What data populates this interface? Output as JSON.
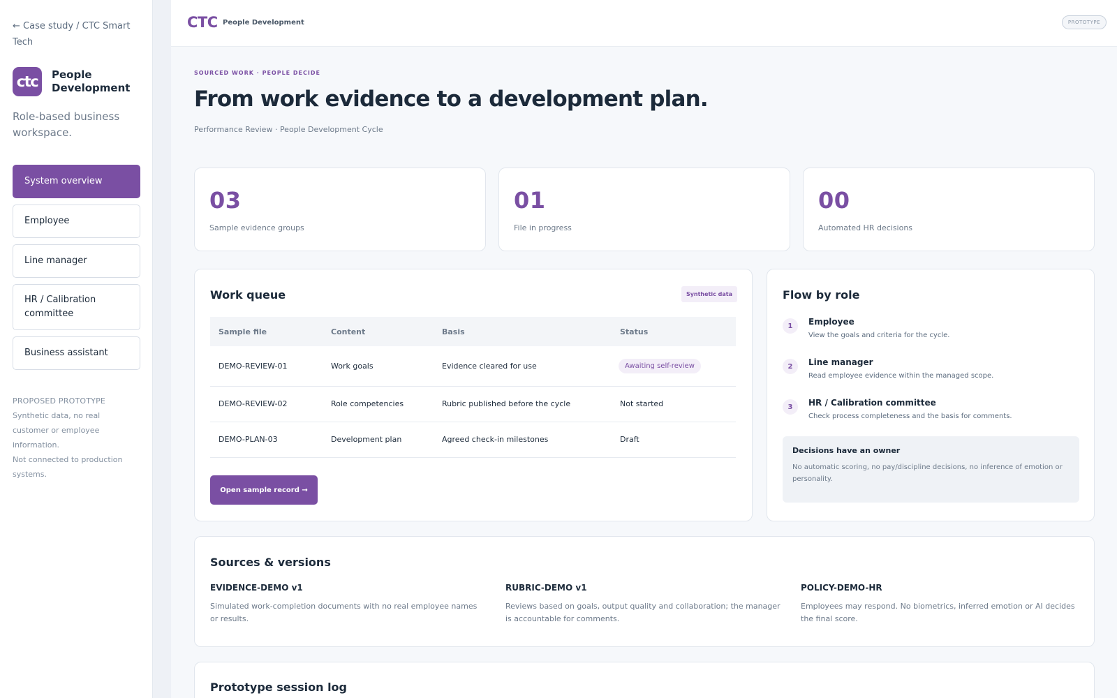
{
  "sidebar": {
    "back_link": "← Case study / CTC Smart Tech",
    "logo_text": "ctc",
    "brand_name": "People Development",
    "tagline": "Role-based business workspace.",
    "nav": [
      {
        "label": "System overview",
        "active": true
      },
      {
        "label": "Employee",
        "active": false
      },
      {
        "label": "Line manager",
        "active": false
      },
      {
        "label": "HR / Calibration committee",
        "active": false
      },
      {
        "label": "Business assistant",
        "active": false
      }
    ],
    "proposed": {
      "title": "PROPOSED PROTOTYPE",
      "line1": "Synthetic data, no real customer or employee information.",
      "line2": "Not connected to production systems."
    }
  },
  "topbar": {
    "brand": "CTC",
    "section": "People Development",
    "badge": "PROTOTYPE"
  },
  "header": {
    "eyebrow": "SOURCED WORK · PEOPLE DECIDE",
    "title": "From work evidence to a development plan.",
    "subtitle": "Performance Review · People Development Cycle"
  },
  "stats": [
    {
      "value": "03",
      "label": "Sample evidence groups"
    },
    {
      "value": "01",
      "label": "File in progress"
    },
    {
      "value": "00",
      "label": "Automated HR decisions"
    }
  ],
  "work_queue": {
    "title": "Work queue",
    "badge": "Synthetic data",
    "columns": [
      "Sample file",
      "Content",
      "Basis",
      "Status"
    ],
    "rows": [
      {
        "file": "DEMO-REVIEW-01",
        "content": "Work goals",
        "basis": "Evidence cleared for use",
        "status": "Awaiting self-review"
      },
      {
        "file": "DEMO-REVIEW-02",
        "content": "Role competencies",
        "basis": "Rubric published before the cycle",
        "status": "Not started"
      },
      {
        "file": "DEMO-PLAN-03",
        "content": "Development plan",
        "basis": "Agreed check-in milestones",
        "status": "Draft"
      }
    ],
    "button": "Open sample record →"
  },
  "flow": {
    "title": "Flow by role",
    "steps": [
      {
        "num": "1",
        "role": "Employee",
        "desc": "View the goals and criteria for the cycle."
      },
      {
        "num": "2",
        "role": "Line manager",
        "desc": "Read employee evidence within the managed scope."
      },
      {
        "num": "3",
        "role": "HR / Calibration committee",
        "desc": "Check process completeness and the basis for comments."
      }
    ],
    "decision_title": "Decisions have an owner",
    "decision_text": "No automatic scoring, no pay/discipline decisions, no inference of emotion or personality."
  },
  "sources": {
    "title": "Sources & versions",
    "items": [
      {
        "name": "EVIDENCE-DEMO v1",
        "desc": "Simulated work-completion documents with no real employee names or results."
      },
      {
        "name": "RUBRIC-DEMO v1",
        "desc": "Reviews based on goals, output quality and collaboration; the manager is accountable for comments."
      },
      {
        "name": "POLICY-DEMO-HR",
        "desc": "Employees may respond. No biometrics, inferred emotion or AI decides the final score."
      }
    ]
  },
  "session_log": {
    "title": "Prototype session log"
  },
  "colors": {
    "accent": "#7a4fa3",
    "text": "#1c2a3a",
    "muted": "#6d7a8a",
    "page_bg": "#f6f8fb"
  }
}
